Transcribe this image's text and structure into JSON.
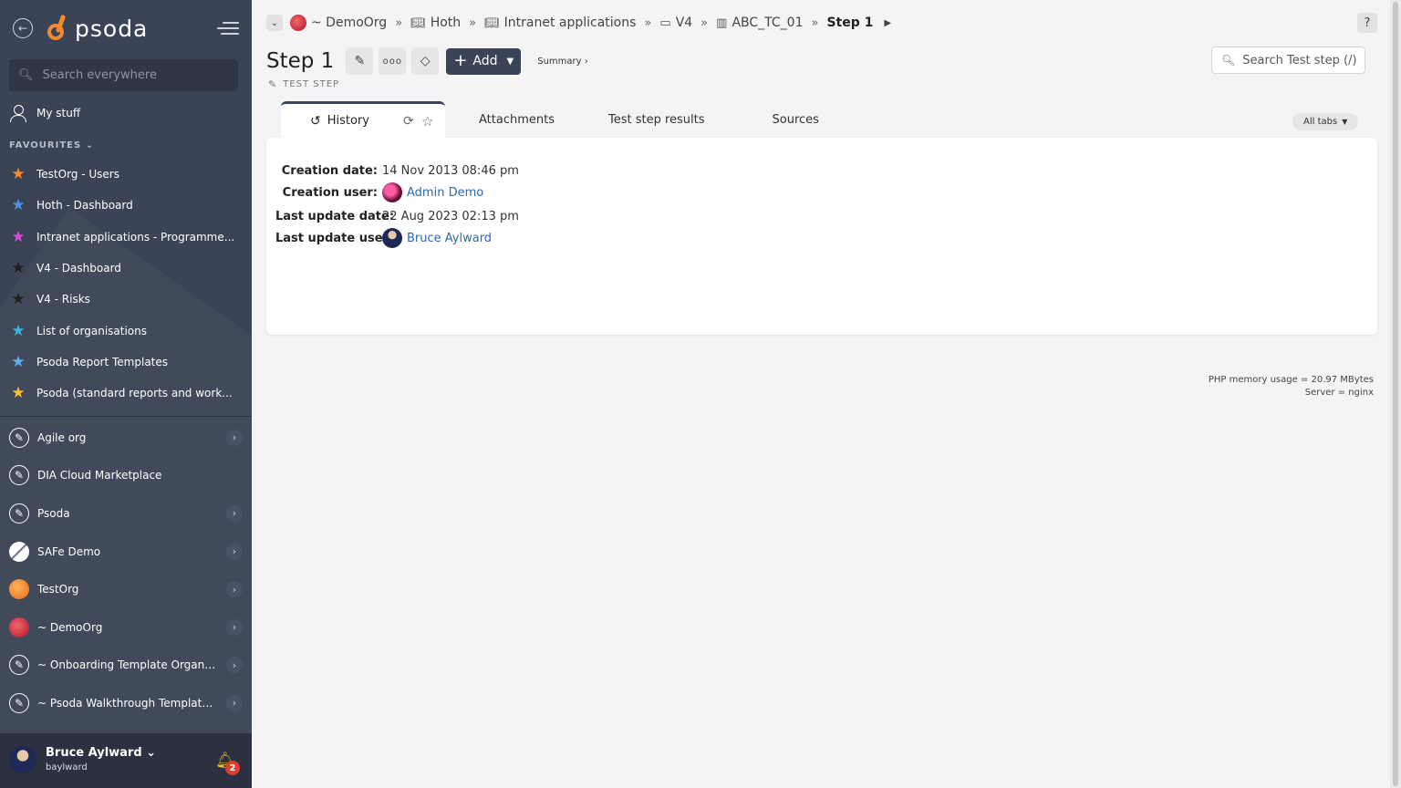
{
  "sidebar": {
    "logo_text": "psoda",
    "search_placeholder": "Search everywhere",
    "my_stuff": "My stuff",
    "favourites_heading": "FAVOURITES",
    "favourites": [
      {
        "label": "TestOrg - Users",
        "color": "#f28a2e"
      },
      {
        "label": "Hoth - Dashboard",
        "color": "#4a90e2"
      },
      {
        "label": "Intranet applications - Programme...",
        "color": "#d64ad6"
      },
      {
        "label": "V4 - Dashboard",
        "color": "#1f1f1f"
      },
      {
        "label": "V4 - Risks",
        "color": "#1f1f1f"
      },
      {
        "label": "List of organisations",
        "color": "#3bb6d9"
      },
      {
        "label": "Psoda Report Templates",
        "color": "#5ab3e8"
      },
      {
        "label": "Psoda (standard reports and work...",
        "color": "#f2c12e"
      }
    ],
    "organisations": [
      {
        "label": "Agile org",
        "icon": "pencil",
        "chevron": true
      },
      {
        "label": "DIA Cloud Marketplace",
        "icon": "pencil",
        "chevron": false
      },
      {
        "label": "Psoda",
        "icon": "pencil",
        "chevron": true
      },
      {
        "label": "SAFe Demo",
        "icon": "safe",
        "chevron": true
      },
      {
        "label": "TestOrg",
        "icon": "orange",
        "chevron": true
      },
      {
        "label": "~ DemoOrg",
        "icon": "red",
        "chevron": true
      },
      {
        "label": "~ Onboarding Template Organisa...",
        "icon": "pencil",
        "chevron": true
      },
      {
        "label": "~ Psoda Walkthrough Template P...",
        "icon": "pencil",
        "chevron": true
      }
    ],
    "user": {
      "name": "Bruce Aylward",
      "username": "baylward",
      "notifications": "2"
    }
  },
  "breadcrumb": {
    "items": [
      {
        "label": "~ DemoOrg",
        "icon": "org"
      },
      {
        "label": "Hoth",
        "icon": "book"
      },
      {
        "label": "Intranet applications",
        "icon": "book"
      },
      {
        "label": "V4",
        "icon": "folder"
      },
      {
        "label": "ABC_TC_01",
        "icon": "table"
      }
    ],
    "current": "Step 1"
  },
  "header": {
    "title": "Step 1",
    "subtitle": "TEST STEP",
    "add_label": "Add",
    "summary_label": "Summary ›",
    "search_placeholder": "Search Test step (/)",
    "help_label": "?"
  },
  "tabs": {
    "active": "History",
    "others": [
      "Attachments",
      "Test step results",
      "Sources"
    ],
    "all_tabs": "All tabs"
  },
  "history": {
    "creation_date_label": "Creation date:",
    "creation_date": "14 Nov 2013 08:46 pm",
    "creation_user_label": "Creation user:",
    "creation_user": "Admin Demo",
    "last_update_date_label": "Last update date:",
    "last_update_date": "22 Aug 2023 02:13 pm",
    "last_update_user_label": "Last update user:",
    "last_update_user": "Bruce Aylward"
  },
  "footer": {
    "memory": "PHP memory usage = 20.97 MBytes",
    "server": "Server = nginx"
  }
}
